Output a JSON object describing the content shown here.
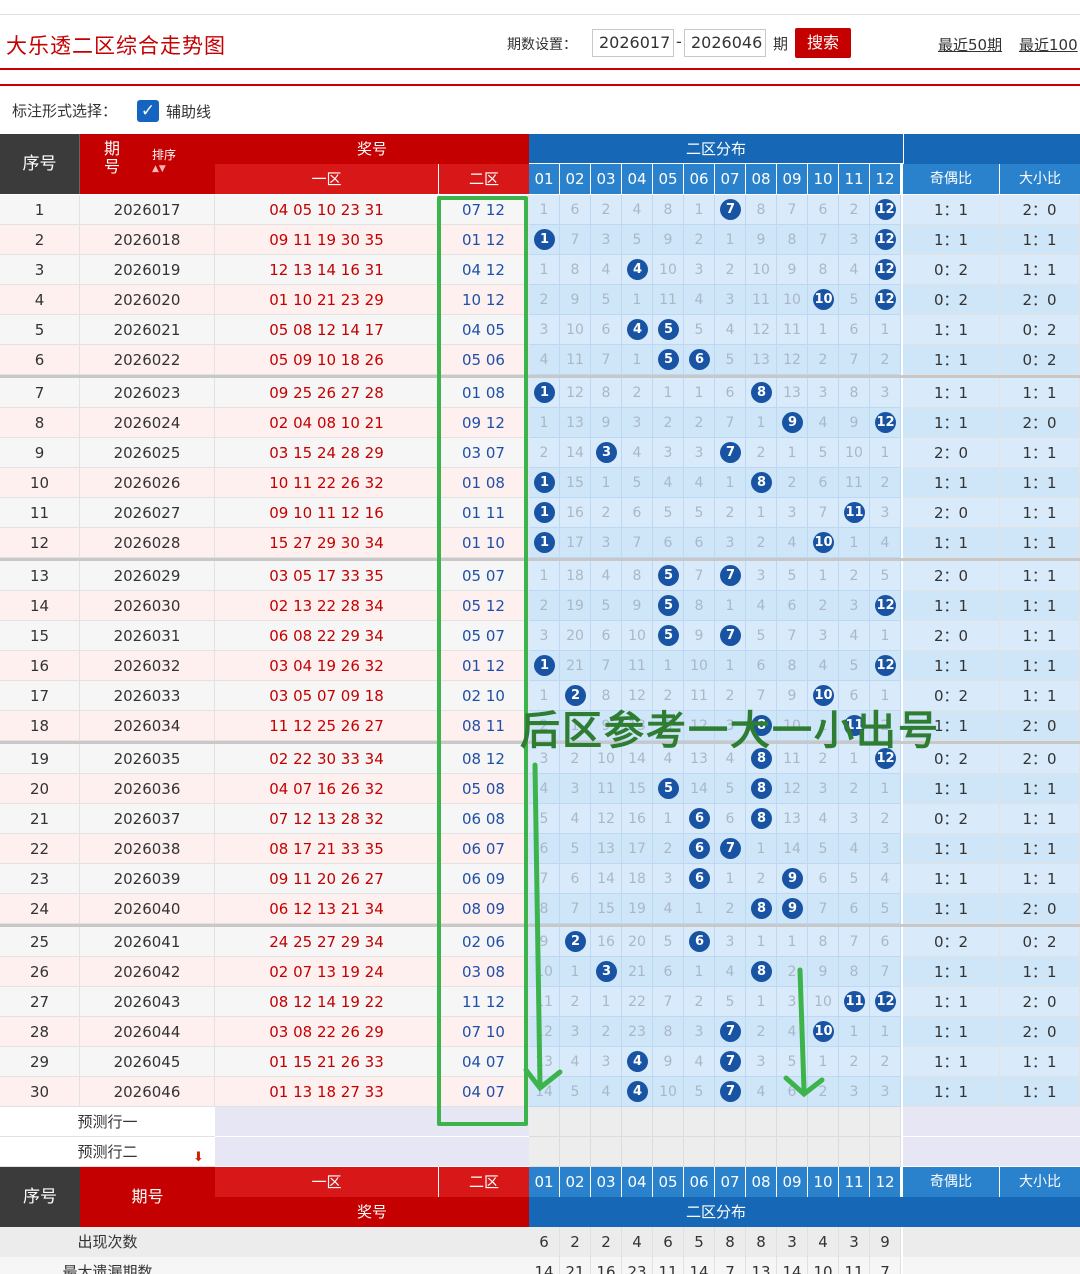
{
  "page": {
    "title": "大乐透二区综合走势图",
    "period_label": "期数设置：",
    "period_from": "2026017",
    "period_to": "2026046",
    "period_unit": "期",
    "search_label": "搜索",
    "recent_links": [
      "最近50期",
      "最近100"
    ]
  },
  "options": {
    "mark_label": "标注形式选择：",
    "checkbox_label": "辅助线",
    "checked": true
  },
  "header": {
    "seq": "序号",
    "issue": "期号",
    "sort": "排序",
    "draw": "奖号",
    "zone1": "一区",
    "zone2": "二区",
    "dist": "二区分布",
    "cols": [
      "01",
      "02",
      "03",
      "04",
      "05",
      "06",
      "07",
      "08",
      "09",
      "10",
      "11",
      "12"
    ],
    "parity": "奇偶比",
    "size": "大小比"
  },
  "rows": [
    {
      "n": "1",
      "issue": "2026017",
      "z1": "04 05 10 23 31",
      "z2": "07 12",
      "miss": [
        "1",
        "6",
        "2",
        "4",
        "8",
        "1",
        "7",
        "8",
        "7",
        "6",
        "2",
        "12"
      ],
      "hits": [
        7,
        12
      ],
      "odd": "1：1",
      "big": "2：0"
    },
    {
      "n": "2",
      "issue": "2026018",
      "z1": "09 11 19 30 35",
      "z2": "01 12",
      "miss": [
        "1",
        "7",
        "3",
        "5",
        "9",
        "2",
        "1",
        "9",
        "8",
        "7",
        "3",
        "12"
      ],
      "hits": [
        1,
        12
      ],
      "odd": "1：1",
      "big": "1：1"
    },
    {
      "n": "3",
      "issue": "2026019",
      "z1": "12 13 14 16 31",
      "z2": "04 12",
      "miss": [
        "1",
        "8",
        "4",
        "4",
        "10",
        "3",
        "2",
        "10",
        "9",
        "8",
        "4",
        "12"
      ],
      "hits": [
        4,
        12
      ],
      "odd": "0：2",
      "big": "1：1"
    },
    {
      "n": "4",
      "issue": "2026020",
      "z1": "01 10 21 23 29",
      "z2": "10 12",
      "miss": [
        "2",
        "9",
        "5",
        "1",
        "11",
        "4",
        "3",
        "11",
        "10",
        "10",
        "5",
        "12"
      ],
      "hits": [
        10,
        12
      ],
      "odd": "0：2",
      "big": "2：0"
    },
    {
      "n": "5",
      "issue": "2026021",
      "z1": "05 08 12 14 17",
      "z2": "04 05",
      "miss": [
        "3",
        "10",
        "6",
        "4",
        "5",
        "5",
        "4",
        "12",
        "11",
        "1",
        "6",
        "1"
      ],
      "hits": [
        4,
        5
      ],
      "odd": "1：1",
      "big": "0：2"
    },
    {
      "n": "6",
      "issue": "2026022",
      "z1": "05 09 10 18 26",
      "z2": "05 06",
      "miss": [
        "4",
        "11",
        "7",
        "1",
        "5",
        "6",
        "5",
        "13",
        "12",
        "2",
        "7",
        "2"
      ],
      "hits": [
        5,
        6
      ],
      "odd": "1：1",
      "big": "0：2"
    },
    {
      "n": "7",
      "issue": "2026023",
      "z1": "09 25 26 27 28",
      "z2": "01 08",
      "miss": [
        "1",
        "12",
        "8",
        "2",
        "1",
        "1",
        "6",
        "8",
        "13",
        "3",
        "8",
        "3"
      ],
      "hits": [
        1,
        8
      ],
      "odd": "1：1",
      "big": "1：1"
    },
    {
      "n": "8",
      "issue": "2026024",
      "z1": "02 04 08 10 21",
      "z2": "09 12",
      "miss": [
        "1",
        "13",
        "9",
        "3",
        "2",
        "2",
        "7",
        "1",
        "9",
        "4",
        "9",
        "12"
      ],
      "hits": [
        9,
        12
      ],
      "odd": "1：1",
      "big": "2：0"
    },
    {
      "n": "9",
      "issue": "2026025",
      "z1": "03 15 24 28 29",
      "z2": "03 07",
      "miss": [
        "2",
        "14",
        "3",
        "4",
        "3",
        "3",
        "7",
        "2",
        "1",
        "5",
        "10",
        "1"
      ],
      "hits": [
        3,
        7
      ],
      "odd": "2：0",
      "big": "1：1"
    },
    {
      "n": "10",
      "issue": "2026026",
      "z1": "10 11 22 26 32",
      "z2": "01 08",
      "miss": [
        "1",
        "15",
        "1",
        "5",
        "4",
        "4",
        "1",
        "8",
        "2",
        "6",
        "11",
        "2"
      ],
      "hits": [
        1,
        8
      ],
      "odd": "1：1",
      "big": "1：1"
    },
    {
      "n": "11",
      "issue": "2026027",
      "z1": "09 10 11 12 16",
      "z2": "01 11",
      "miss": [
        "1",
        "16",
        "2",
        "6",
        "5",
        "5",
        "2",
        "1",
        "3",
        "7",
        "11",
        "3"
      ],
      "hits": [
        1,
        11
      ],
      "odd": "2：0",
      "big": "1：1"
    },
    {
      "n": "12",
      "issue": "2026028",
      "z1": "15 27 29 30 34",
      "z2": "01 10",
      "miss": [
        "1",
        "17",
        "3",
        "7",
        "6",
        "6",
        "3",
        "2",
        "4",
        "10",
        "1",
        "4"
      ],
      "hits": [
        1,
        10
      ],
      "odd": "1：1",
      "big": "1：1"
    },
    {
      "n": "13",
      "issue": "2026029",
      "z1": "03 05 17 33 35",
      "z2": "05 07",
      "miss": [
        "1",
        "18",
        "4",
        "8",
        "5",
        "7",
        "7",
        "3",
        "5",
        "1",
        "2",
        "5"
      ],
      "hits": [
        5,
        7
      ],
      "odd": "2：0",
      "big": "1：1"
    },
    {
      "n": "14",
      "issue": "2026030",
      "z1": "02 13 22 28 34",
      "z2": "05 12",
      "miss": [
        "2",
        "19",
        "5",
        "9",
        "5",
        "8",
        "1",
        "4",
        "6",
        "2",
        "3",
        "12"
      ],
      "hits": [
        5,
        12
      ],
      "odd": "1：1",
      "big": "1：1"
    },
    {
      "n": "15",
      "issue": "2026031",
      "z1": "06 08 22 29 34",
      "z2": "05 07",
      "miss": [
        "3",
        "20",
        "6",
        "10",
        "5",
        "9",
        "7",
        "5",
        "7",
        "3",
        "4",
        "1"
      ],
      "hits": [
        5,
        7
      ],
      "odd": "2：0",
      "big": "1：1"
    },
    {
      "n": "16",
      "issue": "2026032",
      "z1": "03 04 19 26 32",
      "z2": "01 12",
      "miss": [
        "1",
        "21",
        "7",
        "11",
        "1",
        "10",
        "1",
        "6",
        "8",
        "4",
        "5",
        "12"
      ],
      "hits": [
        1,
        12
      ],
      "odd": "1：1",
      "big": "1：1"
    },
    {
      "n": "17",
      "issue": "2026033",
      "z1": "03 05 07 09 18",
      "z2": "02 10",
      "miss": [
        "1",
        "2",
        "8",
        "12",
        "2",
        "11",
        "2",
        "7",
        "9",
        "10",
        "6",
        "1"
      ],
      "hits": [
        2,
        10
      ],
      "odd": "0：2",
      "big": "1：1"
    },
    {
      "n": "18",
      "issue": "2026034",
      "z1": "11 12 25 26 27",
      "z2": "08 11",
      "miss": [
        "2",
        "1",
        "9",
        "13",
        "3",
        "12",
        "3",
        "8",
        "10",
        "1",
        "11",
        "2"
      ],
      "hits": [
        8,
        11
      ],
      "odd": "1：1",
      "big": "2：0"
    },
    {
      "n": "19",
      "issue": "2026035",
      "z1": "02 22 30 33 34",
      "z2": "08 12",
      "miss": [
        "3",
        "2",
        "10",
        "14",
        "4",
        "13",
        "4",
        "8",
        "11",
        "2",
        "1",
        "12"
      ],
      "hits": [
        8,
        12
      ],
      "odd": "0：2",
      "big": "2：0"
    },
    {
      "n": "20",
      "issue": "2026036",
      "z1": "04 07 16 26 32",
      "z2": "05 08",
      "miss": [
        "4",
        "3",
        "11",
        "15",
        "5",
        "14",
        "5",
        "8",
        "12",
        "3",
        "2",
        "1"
      ],
      "hits": [
        5,
        8
      ],
      "odd": "1：1",
      "big": "1：1"
    },
    {
      "n": "21",
      "issue": "2026037",
      "z1": "07 12 13 28 32",
      "z2": "06 08",
      "miss": [
        "5",
        "4",
        "12",
        "16",
        "1",
        "6",
        "6",
        "8",
        "13",
        "4",
        "3",
        "2"
      ],
      "hits": [
        6,
        8
      ],
      "odd": "0：2",
      "big": "1：1"
    },
    {
      "n": "22",
      "issue": "2026038",
      "z1": "08 17 21 33 35",
      "z2": "06 07",
      "miss": [
        "6",
        "5",
        "13",
        "17",
        "2",
        "6",
        "7",
        "1",
        "14",
        "5",
        "4",
        "3"
      ],
      "hits": [
        6,
        7
      ],
      "odd": "1：1",
      "big": "1：1"
    },
    {
      "n": "23",
      "issue": "2026039",
      "z1": "09 11 20 26 27",
      "z2": "06 09",
      "miss": [
        "7",
        "6",
        "14",
        "18",
        "3",
        "6",
        "1",
        "2",
        "9",
        "6",
        "5",
        "4"
      ],
      "hits": [
        6,
        9
      ],
      "odd": "1：1",
      "big": "1：1"
    },
    {
      "n": "24",
      "issue": "2026040",
      "z1": "06 12 13 21 34",
      "z2": "08 09",
      "miss": [
        "8",
        "7",
        "15",
        "19",
        "4",
        "1",
        "2",
        "8",
        "9",
        "7",
        "6",
        "5"
      ],
      "hits": [
        8,
        9
      ],
      "odd": "1：1",
      "big": "2：0"
    },
    {
      "n": "25",
      "issue": "2026041",
      "z1": "24 25 27 29 34",
      "z2": "02 06",
      "miss": [
        "9",
        "2",
        "16",
        "20",
        "5",
        "6",
        "3",
        "1",
        "1",
        "8",
        "7",
        "6"
      ],
      "hits": [
        2,
        6
      ],
      "odd": "0：2",
      "big": "0：2"
    },
    {
      "n": "26",
      "issue": "2026042",
      "z1": "02 07 13 19 24",
      "z2": "03 08",
      "miss": [
        "10",
        "1",
        "3",
        "21",
        "6",
        "1",
        "4",
        "8",
        "2",
        "9",
        "8",
        "7"
      ],
      "hits": [
        3,
        8
      ],
      "odd": "1：1",
      "big": "1：1"
    },
    {
      "n": "27",
      "issue": "2026043",
      "z1": "08 12 14 19 22",
      "z2": "11 12",
      "miss": [
        "11",
        "2",
        "1",
        "22",
        "7",
        "2",
        "5",
        "1",
        "3",
        "10",
        "11",
        "12"
      ],
      "hits": [
        11,
        12
      ],
      "odd": "1：1",
      "big": "2：0"
    },
    {
      "n": "28",
      "issue": "2026044",
      "z1": "03 08 22 26 29",
      "z2": "07 10",
      "miss": [
        "12",
        "3",
        "2",
        "23",
        "8",
        "3",
        "7",
        "2",
        "4",
        "10",
        "1",
        "1"
      ],
      "hits": [
        7,
        10
      ],
      "odd": "1：1",
      "big": "2：0"
    },
    {
      "n": "29",
      "issue": "2026045",
      "z1": "01 15 21 26 33",
      "z2": "04 07",
      "miss": [
        "13",
        "4",
        "3",
        "4",
        "9",
        "4",
        "7",
        "3",
        "5",
        "1",
        "2",
        "2"
      ],
      "hits": [
        4,
        7
      ],
      "odd": "1：1",
      "big": "1：1"
    },
    {
      "n": "30",
      "issue": "2026046",
      "z1": "01 13 18 27 33",
      "z2": "04 07",
      "miss": [
        "14",
        "5",
        "4",
        "4",
        "10",
        "5",
        "7",
        "4",
        "6",
        "2",
        "3",
        "3"
      ],
      "hits": [
        4,
        7
      ],
      "odd": "1：1",
      "big": "1：1"
    }
  ],
  "predict": [
    "预测行一",
    "预测行二"
  ],
  "stats": {
    "appear_label": "出现次数",
    "appear": [
      "6",
      "2",
      "2",
      "4",
      "6",
      "5",
      "8",
      "8",
      "3",
      "4",
      "3",
      "9"
    ],
    "maxmiss_label": "最大遗漏期数",
    "maxmiss": [
      "14",
      "21",
      "16",
      "23",
      "11",
      "14",
      "7",
      "13",
      "14",
      "10",
      "11",
      "7"
    ]
  },
  "annotation": "后区参考一大一小出号",
  "colors": {
    "red": "#c40000",
    "blue": "#1668b6",
    "ball": "#1854a3",
    "green": "#3cb44b",
    "annot": "#2e7d32"
  }
}
